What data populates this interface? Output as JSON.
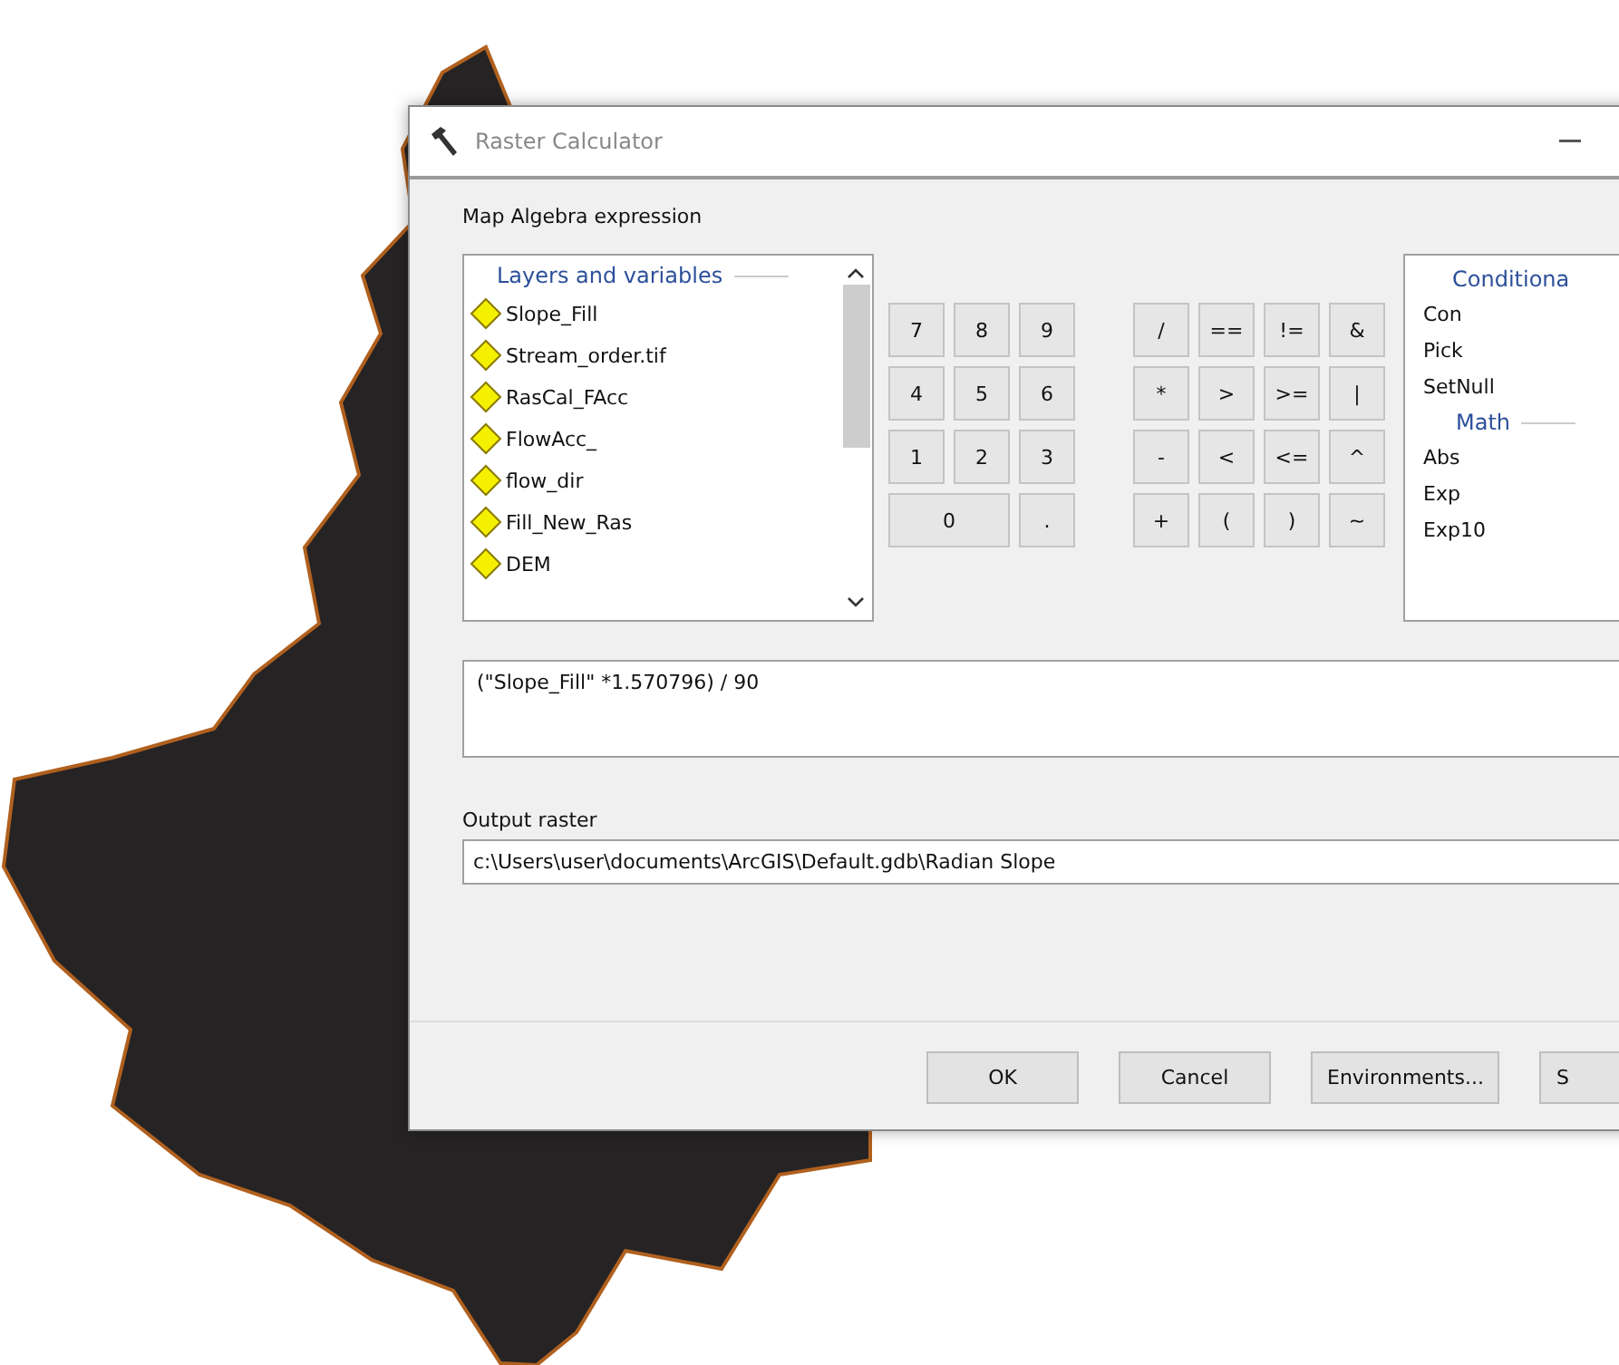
{
  "window": {
    "title": "Raster Calculator"
  },
  "expression_label": "Map Algebra expression",
  "layers": {
    "header": "Layers and variables",
    "items": [
      {
        "label": "Slope_Fill"
      },
      {
        "label": "Stream_order.tif"
      },
      {
        "label": "RasCal_FAcc"
      },
      {
        "label": "FlowAcc_"
      },
      {
        "label": "flow_dir"
      },
      {
        "label": "Fill_New_Ras"
      },
      {
        "label": "DEM"
      }
    ]
  },
  "number_keys": [
    {
      "label": "7",
      "kind": "normal"
    },
    {
      "label": "8",
      "kind": "normal"
    },
    {
      "label": "9",
      "kind": "normal"
    },
    {
      "label": "4",
      "kind": "normal"
    },
    {
      "label": "5",
      "kind": "normal"
    },
    {
      "label": "6",
      "kind": "normal"
    },
    {
      "label": "1",
      "kind": "normal"
    },
    {
      "label": "2",
      "kind": "normal"
    },
    {
      "label": "3",
      "kind": "normal"
    },
    {
      "label": "0",
      "kind": "wide"
    },
    {
      "label": ".",
      "kind": "normal"
    }
  ],
  "operator_keys": [
    "/",
    "==",
    "!=",
    "&",
    "*",
    ">",
    ">=",
    "|",
    "-",
    "<",
    "<=",
    "^",
    "+",
    "(",
    ")",
    "~"
  ],
  "tools": [
    {
      "kind": "header",
      "label": "Conditiona"
    },
    {
      "kind": "item",
      "label": "Con"
    },
    {
      "kind": "item",
      "label": "Pick"
    },
    {
      "kind": "item",
      "label": "SetNull"
    },
    {
      "kind": "header",
      "label": "Math"
    },
    {
      "kind": "item",
      "label": "Abs"
    },
    {
      "kind": "item",
      "label": "Exp"
    },
    {
      "kind": "item",
      "label": "Exp10"
    }
  ],
  "expression": "(\"Slope_Fill\" *1.570796) / 90",
  "output_label": "Output raster",
  "output_value": "c:\\Users\\user\\documents\\ArcGIS\\Default.gdb\\Radian Slope",
  "buttons": [
    "OK",
    "Cancel",
    "Environments...",
    "S"
  ]
}
